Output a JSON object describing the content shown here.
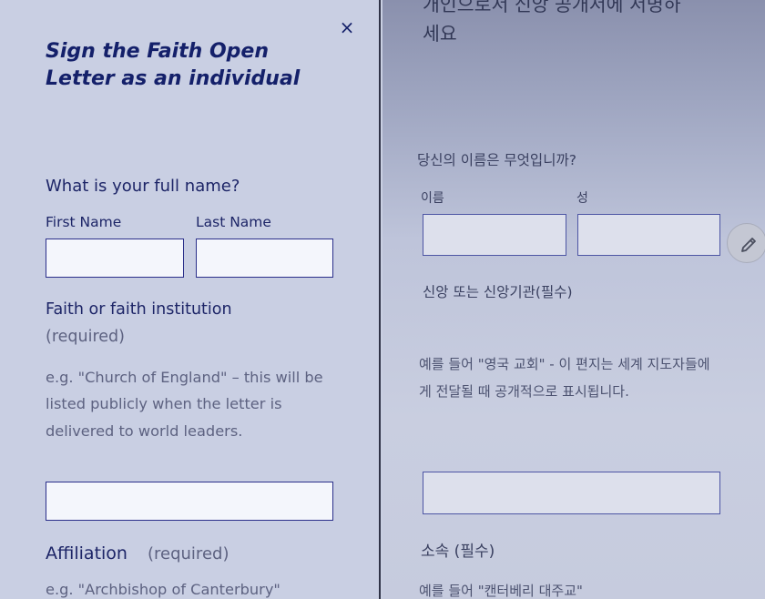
{
  "dialog": {
    "close_glyph": "×",
    "title": "Sign the Faith Open Letter as an individual",
    "name_question": "What is your full name?",
    "first_name_label": "First Name",
    "last_name_label": "Last Name",
    "first_name_value": "",
    "last_name_value": "",
    "faith_label": "Faith or faith institution",
    "faith_required": "(required)",
    "faith_help": "e.g. \"Church of England\" – this will be listed publicly when the letter is delivered to world leaders.",
    "faith_value": "",
    "affiliation_label": "Affiliation",
    "affiliation_required": "(required)",
    "affiliation_help": "e.g. \"Archbishop of Canterbury\""
  },
  "background_page": {
    "title": "개인으로서 신앙 공개서에 서명하세요",
    "name_question": "당신의 이름은 무엇입니까?",
    "first_name_label": "이름",
    "last_name_label": "성",
    "faith_label": "신앙 또는 신앙기관(필수)",
    "faith_help": "예를 들어 \"영국 교회\" - 이 편지는 세계 지도자들에게 전달될 때 공개적으로 표시됩니다.",
    "affiliation_label": "소속 (필수)",
    "affiliation_help": "예를 들어 \"캔터베리 대주교\""
  },
  "icons": {
    "close": "close-icon",
    "edit": "pencil-icon"
  },
  "colors": {
    "panel_bg": "#c9cfe3",
    "title_text": "#14206a",
    "input_border": "#2a2f8a",
    "input_bg": "#f4f6fc"
  }
}
